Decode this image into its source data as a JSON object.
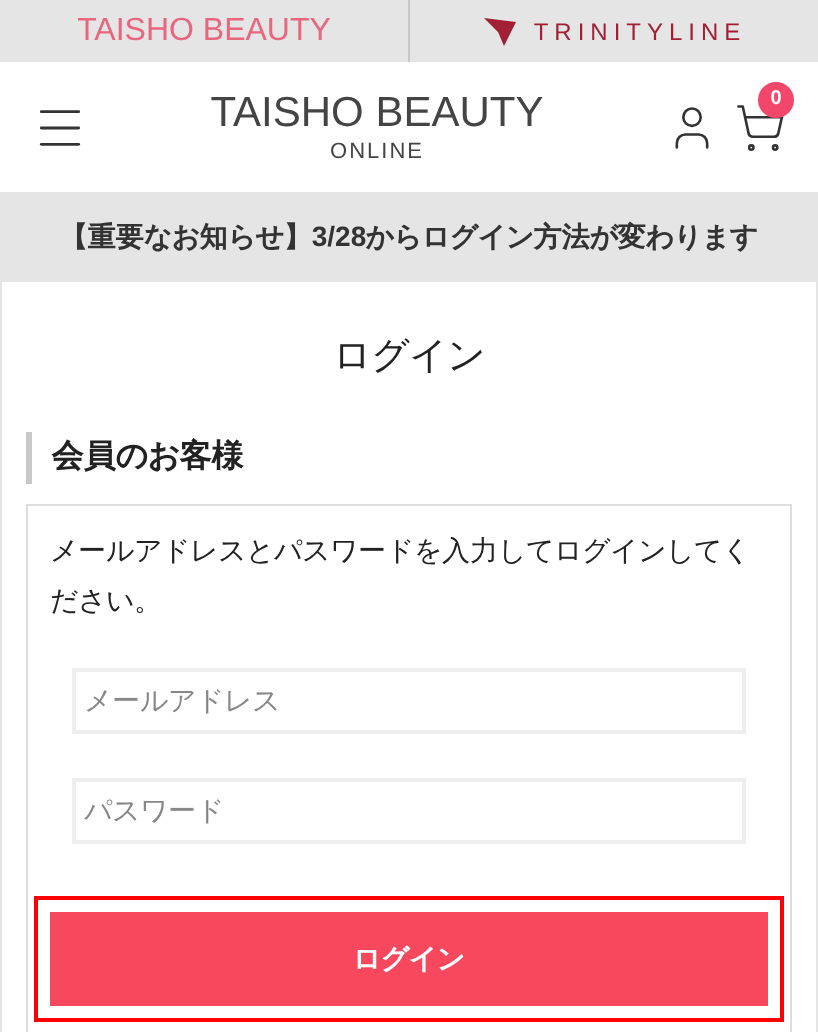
{
  "brand_bar": [
    {
      "label": "TAISHO BEAUTY",
      "kind": "text"
    },
    {
      "label": "TRINITYLINE",
      "kind": "logo"
    }
  ],
  "header": {
    "logo_top": "TAISHO BEAUTY",
    "logo_bottom": "ONLINE",
    "cart_count": "0"
  },
  "notice": "【重要なお知らせ】3/28からログイン方法が変わります",
  "page_title": "ログイン",
  "section_heading": "会員のお客様",
  "instructions": "メールアドレスとパスワードを入力してログインしてください。",
  "fields": [
    {
      "placeholder": "メールアドレス"
    },
    {
      "placeholder": "パスワード"
    }
  ],
  "login_button": {
    "label": "ログイン",
    "focused": true
  }
}
